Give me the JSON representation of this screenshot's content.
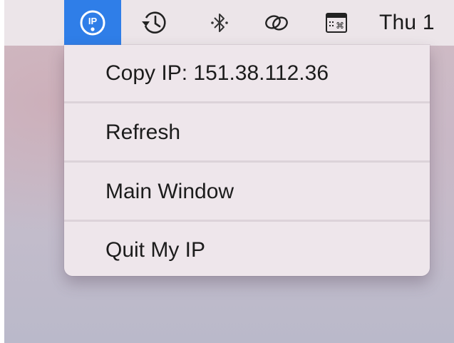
{
  "menubar": {
    "app_icon": "ip-badge-icon",
    "status_icons": [
      "time-machine-icon",
      "bluetooth-icon",
      "chain-link-icon",
      "keyboard-viewer-icon"
    ],
    "clock_text": "Thu 1",
    "accent_color": "#2f7ee8"
  },
  "menu": {
    "items": [
      {
        "label": "Copy IP: 151.38.112.36"
      },
      {
        "label": "Refresh"
      },
      {
        "label": "Main Window"
      },
      {
        "label": "Quit My IP"
      }
    ]
  }
}
